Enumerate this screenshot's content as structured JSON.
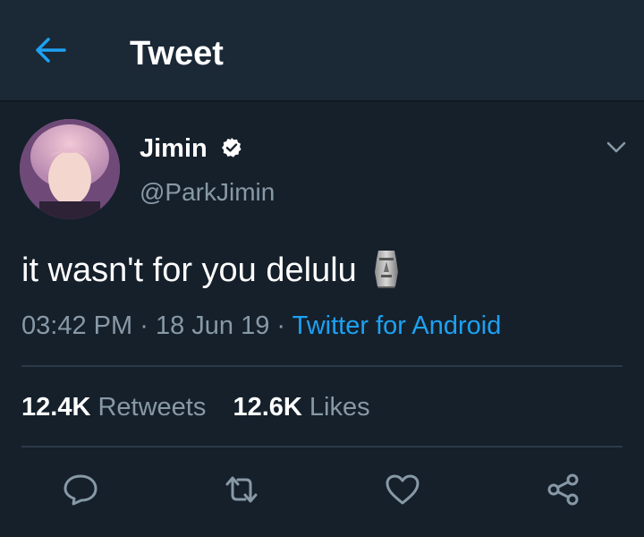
{
  "header": {
    "title": "Tweet",
    "back_icon": "arrow-left-icon"
  },
  "tweet": {
    "author": {
      "display_name": "Jimin",
      "handle": "@ParkJimin",
      "verified": true
    },
    "text": "it wasn't for you delulu",
    "emoji": "moai-icon",
    "time": "03:42 PM",
    "separator": "·",
    "date": "18 Jun 19",
    "source": "Twitter for Android",
    "stats": {
      "retweets_count": "12.4K",
      "retweets_label": "Retweets",
      "likes_count": "12.6K",
      "likes_label": "Likes"
    },
    "actions": [
      "reply-icon",
      "retweet-icon",
      "like-icon",
      "share-icon"
    ]
  },
  "colors": {
    "background": "#15202b",
    "header_background": "#1b2836",
    "accent": "#1da1f2",
    "secondary_text": "#8899a6",
    "divider": "#2c3a48"
  }
}
